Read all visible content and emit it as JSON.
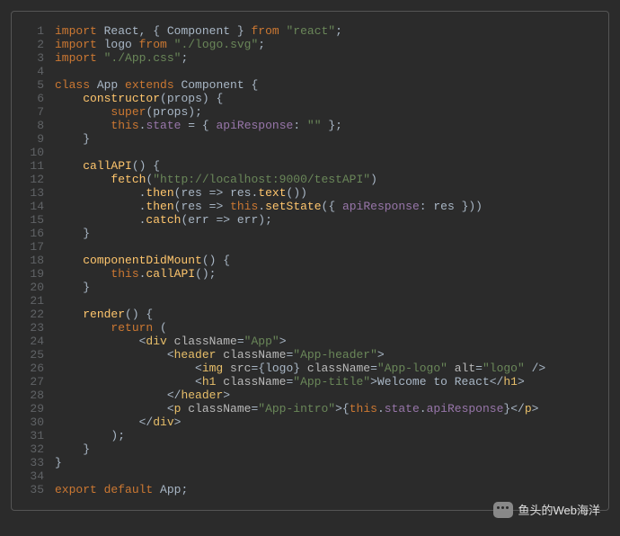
{
  "watermark": "鱼头的Web海洋",
  "code": {
    "lines": [
      [
        [
          "kw",
          "import"
        ],
        [
          "id",
          " React"
        ],
        [
          "punc",
          ", { "
        ],
        [
          "id",
          "Component"
        ],
        [
          "punc",
          " } "
        ],
        [
          "kw",
          "from"
        ],
        [
          "punc",
          " "
        ],
        [
          "str",
          "\"react\""
        ],
        [
          "punc",
          ";"
        ]
      ],
      [
        [
          "kw",
          "import"
        ],
        [
          "id",
          " logo "
        ],
        [
          "kw",
          "from"
        ],
        [
          "punc",
          " "
        ],
        [
          "str",
          "\"./logo.svg\""
        ],
        [
          "punc",
          ";"
        ]
      ],
      [
        [
          "kw",
          "import"
        ],
        [
          "punc",
          " "
        ],
        [
          "str",
          "\"./App.css\""
        ],
        [
          "punc",
          ";"
        ]
      ],
      [],
      [
        [
          "kw",
          "class"
        ],
        [
          "id",
          " App "
        ],
        [
          "kw",
          "extends"
        ],
        [
          "id",
          " Component "
        ],
        [
          "punc",
          "{"
        ]
      ],
      [
        [
          "punc",
          "    "
        ],
        [
          "fn",
          "constructor"
        ],
        [
          "punc",
          "("
        ],
        [
          "param",
          "props"
        ],
        [
          "punc",
          ") {"
        ]
      ],
      [
        [
          "punc",
          "        "
        ],
        [
          "kw",
          "super"
        ],
        [
          "punc",
          "("
        ],
        [
          "param",
          "props"
        ],
        [
          "punc",
          ");"
        ]
      ],
      [
        [
          "punc",
          "        "
        ],
        [
          "kw",
          "this"
        ],
        [
          "punc",
          "."
        ],
        [
          "prop",
          "state"
        ],
        [
          "punc",
          " = { "
        ],
        [
          "prop",
          "apiResponse"
        ],
        [
          "punc",
          ": "
        ],
        [
          "str",
          "\"\""
        ],
        [
          "punc",
          " };"
        ]
      ],
      [
        [
          "punc",
          "    }"
        ]
      ],
      [],
      [
        [
          "punc",
          "    "
        ],
        [
          "fn",
          "callAPI"
        ],
        [
          "punc",
          "() {"
        ]
      ],
      [
        [
          "punc",
          "        "
        ],
        [
          "fn",
          "fetch"
        ],
        [
          "punc",
          "("
        ],
        [
          "str",
          "\"http://localhost:9000/testAPI\""
        ],
        [
          "punc",
          ")"
        ]
      ],
      [
        [
          "punc",
          "            ."
        ],
        [
          "fn",
          "then"
        ],
        [
          "punc",
          "("
        ],
        [
          "param",
          "res"
        ],
        [
          "punc",
          " => "
        ],
        [
          "param",
          "res"
        ],
        [
          "punc",
          "."
        ],
        [
          "fn",
          "text"
        ],
        [
          "punc",
          "())"
        ]
      ],
      [
        [
          "punc",
          "            ."
        ],
        [
          "fn",
          "then"
        ],
        [
          "punc",
          "("
        ],
        [
          "param",
          "res"
        ],
        [
          "punc",
          " => "
        ],
        [
          "kw",
          "this"
        ],
        [
          "punc",
          "."
        ],
        [
          "fn",
          "setState"
        ],
        [
          "punc",
          "({ "
        ],
        [
          "prop",
          "apiResponse"
        ],
        [
          "punc",
          ": "
        ],
        [
          "param",
          "res"
        ],
        [
          "punc",
          " }))"
        ]
      ],
      [
        [
          "punc",
          "            ."
        ],
        [
          "fn",
          "catch"
        ],
        [
          "punc",
          "("
        ],
        [
          "param",
          "err"
        ],
        [
          "punc",
          " => "
        ],
        [
          "param",
          "err"
        ],
        [
          "punc",
          ");"
        ]
      ],
      [
        [
          "punc",
          "    }"
        ]
      ],
      [],
      [
        [
          "punc",
          "    "
        ],
        [
          "fn",
          "componentDidMount"
        ],
        [
          "punc",
          "() {"
        ]
      ],
      [
        [
          "punc",
          "        "
        ],
        [
          "kw",
          "this"
        ],
        [
          "punc",
          "."
        ],
        [
          "fn",
          "callAPI"
        ],
        [
          "punc",
          "();"
        ]
      ],
      [
        [
          "punc",
          "    }"
        ]
      ],
      [],
      [
        [
          "punc",
          "    "
        ],
        [
          "fn",
          "render"
        ],
        [
          "punc",
          "() {"
        ]
      ],
      [
        [
          "punc",
          "        "
        ],
        [
          "kw",
          "return"
        ],
        [
          "punc",
          " ("
        ]
      ],
      [
        [
          "punc",
          "            <"
        ],
        [
          "tag",
          "div"
        ],
        [
          "punc",
          " "
        ],
        [
          "attr",
          "className"
        ],
        [
          "punc",
          "="
        ],
        [
          "str",
          "\"App\""
        ],
        [
          "punc",
          ">"
        ]
      ],
      [
        [
          "punc",
          "                <"
        ],
        [
          "tag",
          "header"
        ],
        [
          "punc",
          " "
        ],
        [
          "attr",
          "className"
        ],
        [
          "punc",
          "="
        ],
        [
          "str",
          "\"App-header\""
        ],
        [
          "punc",
          ">"
        ]
      ],
      [
        [
          "punc",
          "                    <"
        ],
        [
          "tag",
          "img"
        ],
        [
          "punc",
          " "
        ],
        [
          "attr",
          "src"
        ],
        [
          "punc",
          "={"
        ],
        [
          "id",
          "logo"
        ],
        [
          "punc",
          "} "
        ],
        [
          "attr",
          "className"
        ],
        [
          "punc",
          "="
        ],
        [
          "str",
          "\"App-logo\""
        ],
        [
          "punc",
          " "
        ],
        [
          "attr",
          "alt"
        ],
        [
          "punc",
          "="
        ],
        [
          "str",
          "\"logo\""
        ],
        [
          "punc",
          " />"
        ]
      ],
      [
        [
          "punc",
          "                    <"
        ],
        [
          "tag",
          "h1"
        ],
        [
          "punc",
          " "
        ],
        [
          "attr",
          "className"
        ],
        [
          "punc",
          "="
        ],
        [
          "str",
          "\"App-title\""
        ],
        [
          "punc",
          ">"
        ],
        [
          "id",
          "Welcome to React"
        ],
        [
          "punc",
          "</"
        ],
        [
          "tag",
          "h1"
        ],
        [
          "punc",
          ">"
        ]
      ],
      [
        [
          "punc",
          "                </"
        ],
        [
          "tag",
          "header"
        ],
        [
          "punc",
          ">"
        ]
      ],
      [
        [
          "punc",
          "                <"
        ],
        [
          "tag",
          "p"
        ],
        [
          "punc",
          " "
        ],
        [
          "attr",
          "className"
        ],
        [
          "punc",
          "="
        ],
        [
          "str",
          "\"App-intro\""
        ],
        [
          "punc",
          ">{"
        ],
        [
          "kw",
          "this"
        ],
        [
          "punc",
          "."
        ],
        [
          "prop",
          "state"
        ],
        [
          "punc",
          "."
        ],
        [
          "prop",
          "apiResponse"
        ],
        [
          "punc",
          "}</"
        ],
        [
          "tag",
          "p"
        ],
        [
          "punc",
          ">"
        ]
      ],
      [
        [
          "punc",
          "            </"
        ],
        [
          "tag",
          "div"
        ],
        [
          "punc",
          ">"
        ]
      ],
      [
        [
          "punc",
          "        );"
        ]
      ],
      [
        [
          "punc",
          "    }"
        ]
      ],
      [
        [
          "punc",
          "}"
        ]
      ],
      [],
      [
        [
          "kw",
          "export"
        ],
        [
          "punc",
          " "
        ],
        [
          "kw",
          "default"
        ],
        [
          "id",
          " App"
        ],
        [
          "punc",
          ";"
        ]
      ]
    ]
  }
}
